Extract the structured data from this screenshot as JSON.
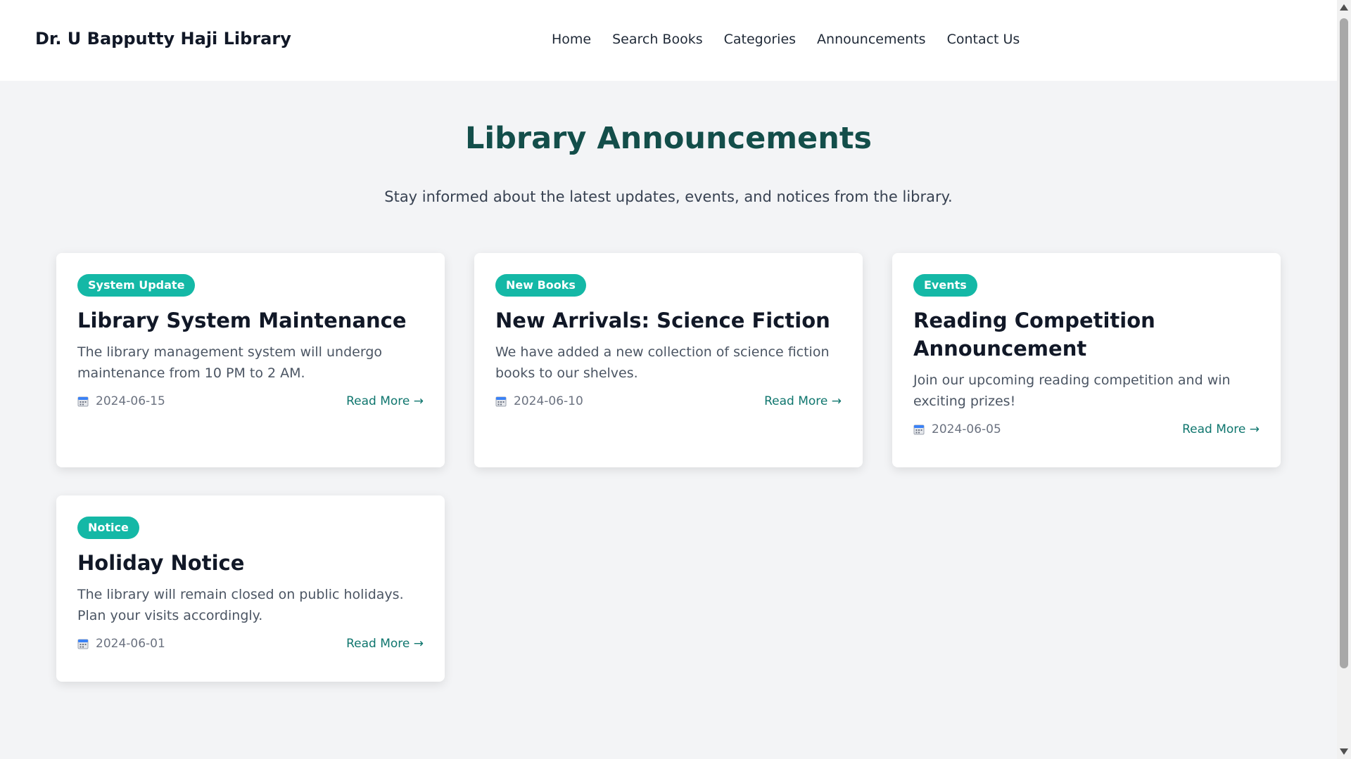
{
  "header": {
    "brand": "Dr. U Bapputty Haji Library",
    "nav": [
      "Home",
      "Search Books",
      "Categories",
      "Announcements",
      "Contact Us"
    ]
  },
  "main": {
    "title": "Library Announcements",
    "subtitle": "Stay informed about the latest updates, events, and notices from the library."
  },
  "cards": [
    {
      "badge": "System Update",
      "title": "Library System Maintenance",
      "description": "The library management system will undergo maintenance from 10 PM to 2 AM.",
      "date": "2024-06-15",
      "read_more": "Read More →"
    },
    {
      "badge": "New Books",
      "title": "New Arrivals: Science Fiction",
      "description": "We have added a new collection of science fiction books to our shelves.",
      "date": "2024-06-10",
      "read_more": "Read More →"
    },
    {
      "badge": "Events",
      "title": "Reading Competition Announcement",
      "description": "Join our upcoming reading competition and win exciting prizes!",
      "date": "2024-06-05",
      "read_more": "Read More →"
    },
    {
      "badge": "Notice",
      "title": "Holiday Notice",
      "description": "The library will remain closed on public holidays. Plan your visits accordingly.",
      "date": "2024-06-01",
      "read_more": "Read More →"
    }
  ],
  "icons": {
    "date": "calendar-icon"
  },
  "colors": {
    "accent": "#14b8a6",
    "heading": "#134e4a",
    "link": "#0f766e"
  }
}
